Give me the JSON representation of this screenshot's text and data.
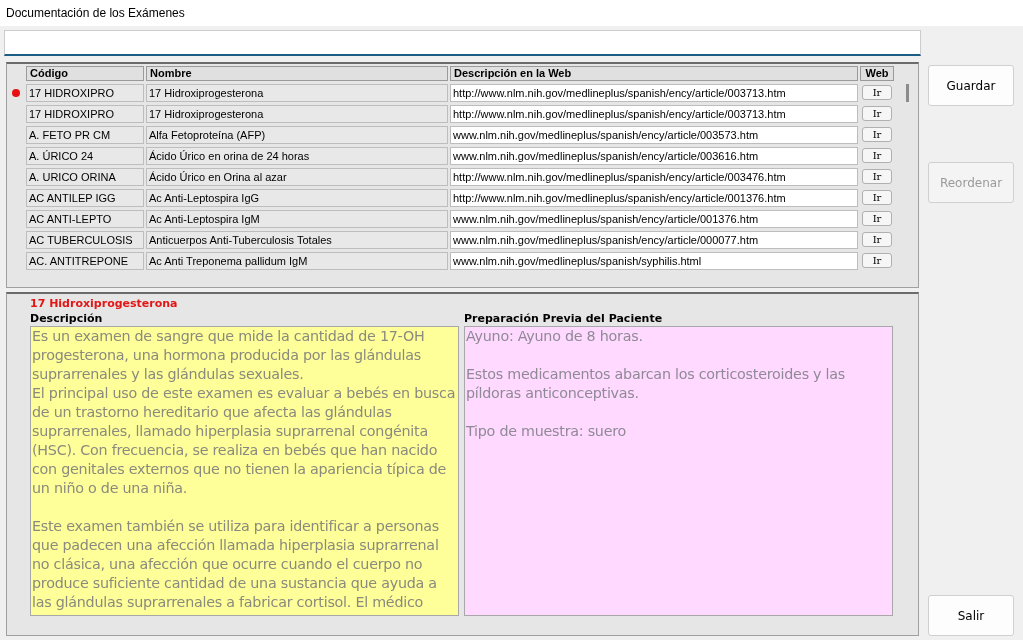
{
  "window": {
    "title": "Documentación de los Exámenes"
  },
  "table": {
    "columns": [
      "Código",
      "Nombre",
      "Descripción en la Web",
      "Web"
    ],
    "rows": [
      {
        "code": "17 HIDROXIPRO",
        "name": "17 Hidroxiprogesterona",
        "url": "http://www.nlm.nih.gov/medlineplus/spanish/ency/article/003713.htm",
        "button": "Ir",
        "selected": true
      },
      {
        "code": "17 HIDROXIPRO",
        "name": "17 Hidroxiprogesterona",
        "url": "http://www.nlm.nih.gov/medlineplus/spanish/ency/article/003713.htm",
        "button": "Ir",
        "selected": false
      },
      {
        "code": "A. FETO PR CM",
        "name": "Alfa Fetoproteína (AFP)",
        "url": "www.nlm.nih.gov/medlineplus/spanish/ency/article/003573.htm",
        "button": "Ir",
        "selected": false
      },
      {
        "code": "A. ÚRICO 24",
        "name": "Ácido Úrico en orina de 24 horas",
        "url": "www.nlm.nih.gov/medlineplus/spanish/ency/article/003616.htm",
        "button": "Ir",
        "selected": false
      },
      {
        "code": "A. URICO ORINA",
        "name": "Ácido Úrico en Orina al azar",
        "url": "http://www.nlm.nih.gov/medlineplus/spanish/ency/article/003476.htm",
        "button": "Ir",
        "selected": false
      },
      {
        "code": "AC ANTILEP IGG",
        "name": "Ac Anti-Leptospira IgG",
        "url": "http://www.nlm.nih.gov/medlineplus/spanish/ency/article/001376.htm",
        "button": "Ir",
        "selected": false
      },
      {
        "code": "AC ANTI-LEPTO",
        "name": "Ac Anti-Leptospira IgM",
        "url": "www.nlm.nih.gov/medlineplus/spanish/ency/article/001376.htm",
        "button": "Ir",
        "selected": false
      },
      {
        "code": "AC TUBERCULOSIS",
        "name": "Anticuerpos Anti-Tuberculosis Totales",
        "url": "www.nlm.nih.gov/medlineplus/spanish/ency/article/000077.htm",
        "button": "Ir",
        "selected": false
      },
      {
        "code": "AC. ANTITREPONE",
        "name": "Ac Anti Treponema pallidum IgM",
        "url": "www.nlm.nih.gov/medlineplus/spanish/syphilis.html",
        "button": "Ir",
        "selected": false
      }
    ]
  },
  "detail": {
    "title": "17 Hidroxiprogesterona",
    "description_label": "Descripción",
    "description": "Es un examen de sangre que mide la cantidad de 17-OH\nprogesterona, una hormona producida por las glándulas\nsuprarrenales y las glándulas sexuales.\nEl principal uso de este examen es evaluar a bebés en busca\nde un trastorno hereditario que afecta las glándulas\nsuprarrenales, llamado hiperplasia suprarrenal congénita\n(HSC). Con frecuencia, se realiza en bebés que han nacido\ncon genitales externos que no tienen la apariencia típica de\nun niño o de una niña.\n\nEste examen también se utiliza para identificar a personas\nque padecen una afección llamada hiperplasia suprarrenal\nno clásica, una afección que ocurre cuando el cuerpo no\nproduce suficiente cantidad de una sustancia que ayuda a\nlas glándulas suprarrenales a fabricar cortisol. El médico",
    "preparation_label": "Preparación Previa del Paciente",
    "preparation": "Ayuno: Ayuno de 8 horas.\n\nEstos medicamentos abarcan los corticosteroides y las\npíldoras anticonceptivas.\n\nTipo de muestra: suero"
  },
  "buttons": [
    {
      "label": "Guardar",
      "disabled": false
    },
    {
      "label": "Reordenar",
      "disabled": true
    },
    {
      "label": "Salir",
      "disabled": false
    }
  ]
}
